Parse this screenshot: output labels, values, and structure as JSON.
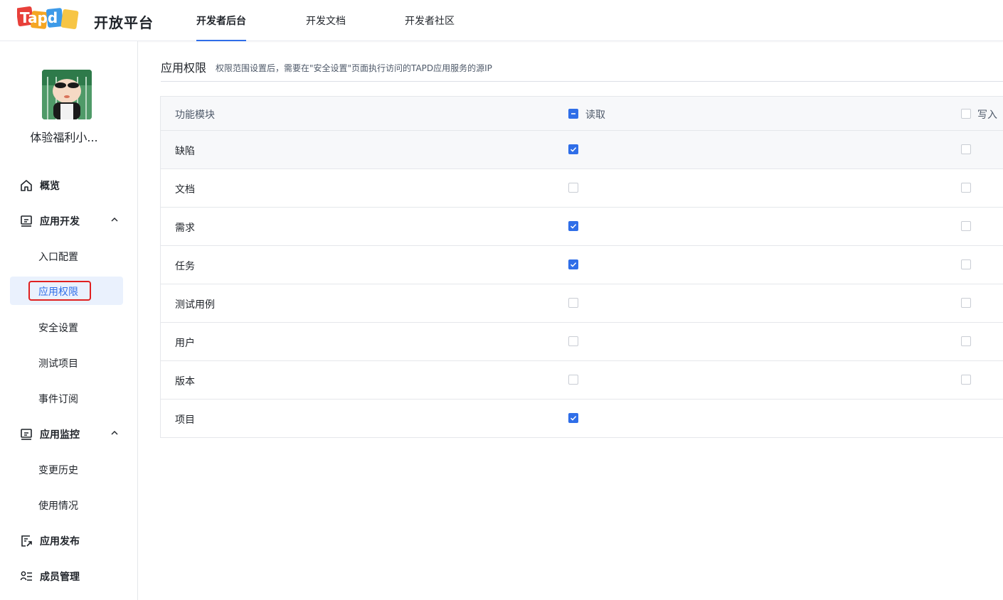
{
  "header": {
    "logo_text": "Tapd",
    "platform_title": "开放平台",
    "tabs": [
      {
        "label": "开发者后台",
        "active": true
      },
      {
        "label": "开发文档",
        "active": false
      },
      {
        "label": "开发者社区",
        "active": false
      }
    ]
  },
  "sidebar": {
    "app_name": "体验福利小...",
    "items": [
      {
        "label": "概览",
        "icon": "home-icon"
      },
      {
        "label": "应用开发",
        "icon": "monitor-icon",
        "expanded": true
      },
      {
        "label": "入口配置"
      },
      {
        "label": "应用权限",
        "selected": true
      },
      {
        "label": "安全设置"
      },
      {
        "label": "测试项目"
      },
      {
        "label": "事件订阅"
      },
      {
        "label": "应用监控",
        "icon": "monitor-icon",
        "expanded": true
      },
      {
        "label": "变更历史"
      },
      {
        "label": "使用情况"
      },
      {
        "label": "应用发布",
        "icon": "publish-icon"
      },
      {
        "label": "成员管理",
        "icon": "members-icon"
      }
    ]
  },
  "main": {
    "title": "应用权限",
    "hint": "权限范围设置后，需要在\"安全设置\"页面执行访问的TAPD应用服务的源IP",
    "table": {
      "headers": {
        "module": "功能模块",
        "read": "读取",
        "write": "写入"
      },
      "header_read_state": "indeterminate",
      "header_write_state": "unchecked",
      "rows": [
        {
          "module": "缺陷",
          "read": true,
          "write": false
        },
        {
          "module": "文档",
          "read": false,
          "write": false
        },
        {
          "module": "需求",
          "read": true,
          "write": false
        },
        {
          "module": "任务",
          "read": true,
          "write": false
        },
        {
          "module": "测试用例",
          "read": false,
          "write": false
        },
        {
          "module": "用户",
          "read": false,
          "write": false
        },
        {
          "module": "版本",
          "read": false,
          "write": false
        },
        {
          "module": "项目",
          "read": true,
          "write": null
        }
      ]
    }
  },
  "colors": {
    "accent": "#2f6ee8",
    "highlight": "#e02020",
    "selected_bg": "#eaf1fd"
  }
}
